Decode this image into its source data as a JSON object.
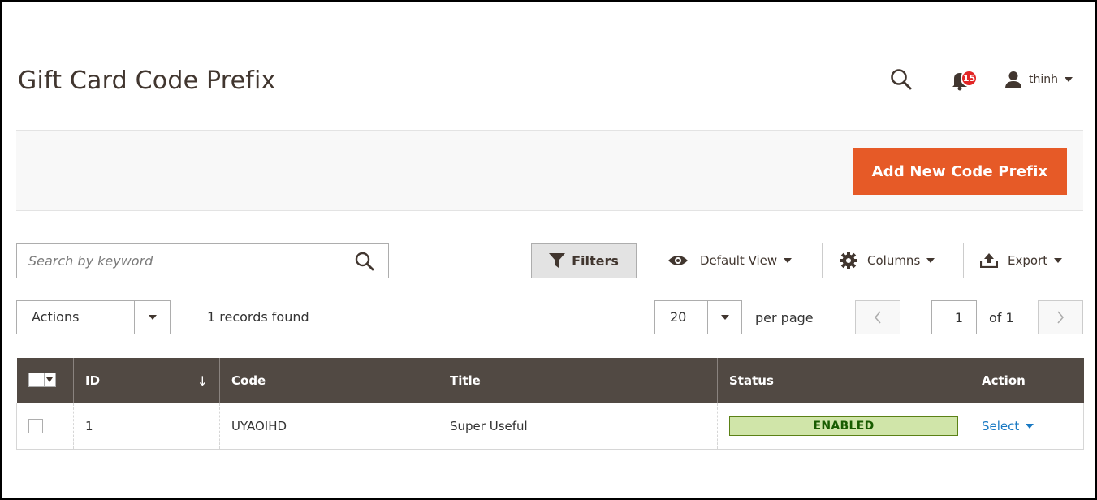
{
  "page": {
    "title": "Gift Card Code Prefix"
  },
  "header": {
    "notification_count": "15",
    "user_name": "thinh"
  },
  "actions_bar": {
    "add_button_label": "Add New Code Prefix"
  },
  "toolbar": {
    "search_placeholder": "Search by keyword",
    "filters_label": "Filters",
    "view_label": "Default View",
    "columns_label": "Columns",
    "export_label": "Export",
    "mass_actions_label": "Actions",
    "records_found": "1 records found",
    "per_page_value": "20",
    "per_page_label": "per page",
    "current_page": "1",
    "total_pages_label": "of 1"
  },
  "grid": {
    "columns": [
      "ID",
      "Code",
      "Title",
      "Status",
      "Action"
    ],
    "sort_indicator": "↓",
    "rows": [
      {
        "id": "1",
        "code": "UYAOIHD",
        "title": "Super Useful",
        "status": "ENABLED",
        "action": "Select"
      }
    ]
  },
  "colors": {
    "primary_button": "#e65a27",
    "grid_header": "#514943",
    "link": "#1979c3",
    "status_enabled_bg": "#d0e5a9",
    "badge": "#e22626"
  }
}
